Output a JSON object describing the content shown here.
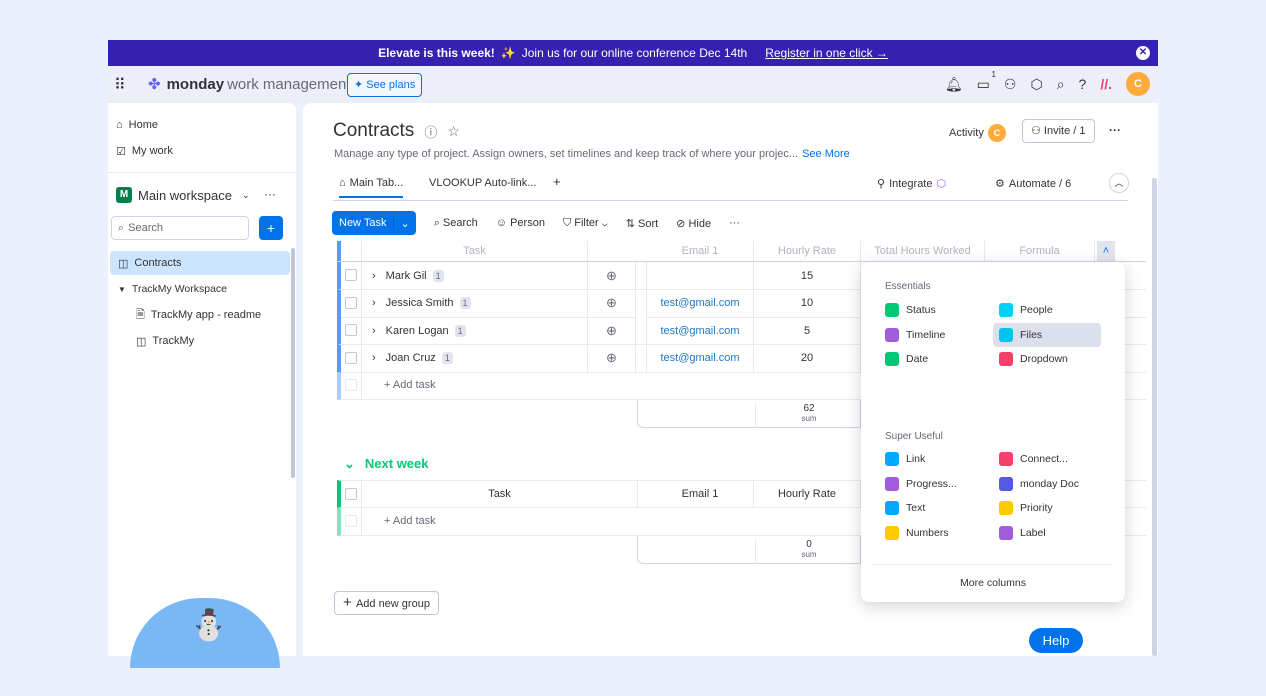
{
  "banner": {
    "bold": "Elevate is this week!",
    "text": "Join us for our online conference Dec 14th",
    "link": "Register in one click →"
  },
  "topbar": {
    "brand": "monday",
    "product": "work management",
    "see_plans": "See plans",
    "inbox_count": "1",
    "avatar": "C"
  },
  "sidebar": {
    "home": "Home",
    "my_work": "My work",
    "workspace": "Main workspace",
    "workspace_initial": "M",
    "search_placeholder": "Search",
    "items": [
      {
        "label": "Contracts",
        "active": true
      },
      {
        "label": "TrackMy Workspace"
      },
      {
        "label": "TrackMy app - readme"
      },
      {
        "label": "TrackMy"
      }
    ]
  },
  "board": {
    "title": "Contracts",
    "description": "Manage any type of project. Assign owners, set timelines and keep track of where your projec...",
    "see_more": "See More",
    "activity": "Activity",
    "activity_avatar": "C",
    "invite": "Invite / 1",
    "tabs": [
      {
        "label": "Main Tab..."
      },
      {
        "label": "VLOOKUP Auto-link..."
      }
    ],
    "add_tab": "+",
    "integrate": "Integrate",
    "automate": "Automate / 6"
  },
  "toolbar": {
    "new_task": "New Task",
    "search": "Search",
    "person": "Person",
    "filter": "Filter",
    "sort": "Sort",
    "hide": "Hide"
  },
  "columns": [
    "Task",
    "Email 1",
    "Hourly Rate",
    "Total Hours Worked",
    "Formula"
  ],
  "group1": {
    "rows": [
      {
        "task": "Mark Gil",
        "subitems": "1",
        "email": "",
        "rate": "15"
      },
      {
        "task": "Jessica Smith",
        "subitems": "1",
        "email": "test@gmail.com",
        "rate": "10"
      },
      {
        "task": "Karen Logan",
        "subitems": "1",
        "email": "test@gmail.com",
        "rate": "5"
      },
      {
        "task": "Joan Cruz",
        "subitems": "1",
        "email": "test@gmail.com",
        "rate": "20"
      }
    ],
    "add_task": "+ Add task",
    "sum": "62",
    "sum_label": "sum",
    "color": "#579bfc"
  },
  "group2": {
    "name": "Next week",
    "add_task": "+ Add task",
    "sum": "0",
    "sum_label": "sum",
    "color": "#00c875"
  },
  "add_group": "Add new group",
  "menu": {
    "essentials": "Essentials",
    "super_useful": "Super Useful",
    "more": "More columns",
    "essential_items": [
      {
        "label": "Status",
        "color": "#00c875"
      },
      {
        "label": "People",
        "color": "#00d2f5"
      },
      {
        "label": "Timeline",
        "color": "#a25ddc"
      },
      {
        "label": "Files",
        "color": "#00c3f2",
        "hover": true
      },
      {
        "label": "Date",
        "color": "#00c875"
      },
      {
        "label": "Dropdown",
        "color": "#f4406b"
      }
    ],
    "useful_items": [
      {
        "label": "Link",
        "color": "#00a9ff"
      },
      {
        "label": "Connect...",
        "color": "#f4406b"
      },
      {
        "label": "Progress...",
        "color": "#a25ddc"
      },
      {
        "label": "monday Doc",
        "color": "#5559df"
      },
      {
        "label": "Text",
        "color": "#00a9ff"
      },
      {
        "label": "Priority",
        "color": "#ffcb00"
      },
      {
        "label": "Numbers",
        "color": "#ffcb00"
      },
      {
        "label": "Label",
        "color": "#a25ddc"
      }
    ]
  },
  "help": "Help"
}
